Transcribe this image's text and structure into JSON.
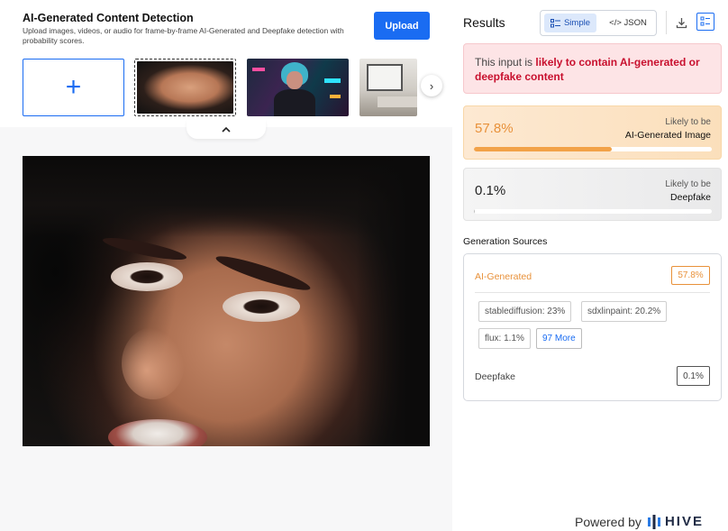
{
  "header": {
    "title": "AI-Generated Content Detection",
    "subtitle": "Upload images, videos, or audio for frame-by-frame AI-Generated and Deepfake detection with probability scores.",
    "upload_label": "Upload"
  },
  "thumbnails": {
    "add_symbol": "+",
    "next_symbol": "›",
    "collapse_symbol": "⌃"
  },
  "results": {
    "title": "Results",
    "view_simple": "Simple",
    "view_json": "</> JSON",
    "alert_prefix": "This input is ",
    "alert_emphasis": "likely to contain AI-generated or deepfake content",
    "cards": [
      {
        "percent_label": "57.8%",
        "value": 57.8,
        "likely_label": "Likely to be",
        "category": "AI-Generated Image"
      },
      {
        "percent_label": "0.1%",
        "value": 0.1,
        "likely_label": "Likely to be",
        "category": "Deepfake"
      }
    ],
    "generation": {
      "title": "Generation Sources",
      "ai_label": "AI-Generated",
      "ai_value": "57.8%",
      "tags": [
        "stablediffusion: 23%",
        "sdxlinpaint: 20.2%",
        "flux: 1.1%"
      ],
      "more_label": "97 More",
      "deepfake_label": "Deepfake",
      "deepfake_value": "0.1%"
    }
  },
  "footer": {
    "powered_by": "Powered by",
    "brand": "HIVE"
  },
  "colors": {
    "accent_blue": "#1a6cf2",
    "ai_orange": "#e8913a",
    "alert_red": "#c8102e"
  }
}
